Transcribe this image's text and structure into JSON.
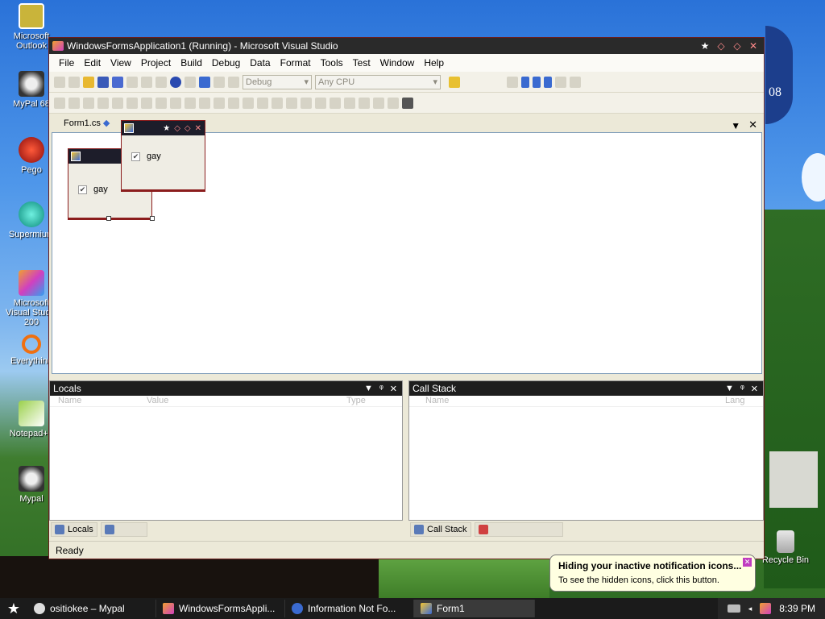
{
  "desktop": {
    "icons": [
      {
        "label": "Microsoft Outlook",
        "icon": "outlook-icon"
      },
      {
        "label": "MyPal 68",
        "icon": "raccoon-icon"
      },
      {
        "label": "Pego",
        "icon": "red-ball-icon"
      },
      {
        "label": "Supermium",
        "icon": "globe-icon"
      },
      {
        "label": "Microsoft Visual Studio 200",
        "icon": "visual-studio-icon"
      },
      {
        "label": "Everything",
        "icon": "everything-icon"
      },
      {
        "label": "Notepad++",
        "icon": "notepad-icon"
      },
      {
        "label": "Mypal",
        "icon": "raccoon-icon"
      },
      {
        "label": "Recycle Bin",
        "icon": "recycle-bin-icon"
      }
    ],
    "calendar_badge": "08"
  },
  "vs": {
    "title": "WindowsFormsApplication1 (Running) - Microsoft Visual Studio",
    "menu": [
      "File",
      "Edit",
      "View",
      "Project",
      "Build",
      "Debug",
      "Data",
      "Format",
      "Tools",
      "Test",
      "Window",
      "Help"
    ],
    "config_combo": "Debug",
    "platform_combo": "Any CPU",
    "doc_tab": "Form1.cs",
    "designer_forms": [
      {
        "checkbox_label": "gay"
      },
      {
        "checkbox_label": "gay"
      }
    ],
    "locals": {
      "title": "Locals",
      "columns": [
        "Name",
        "Value",
        "Type"
      ],
      "tab_active": "Locals"
    },
    "callstack": {
      "title": "Call Stack",
      "columns": [
        "Name",
        "Lang"
      ],
      "tab_active": "Call Stack"
    },
    "status": "Ready"
  },
  "taskbar": {
    "items": [
      "ositiokee – Mypal",
      "WindowsFormsAppli...",
      "Information Not Fo...",
      "Form1"
    ],
    "time": "8:39 PM"
  },
  "balloon": {
    "title": "Hiding your inactive notification icons...",
    "body": "To see the hidden icons, click this button."
  }
}
